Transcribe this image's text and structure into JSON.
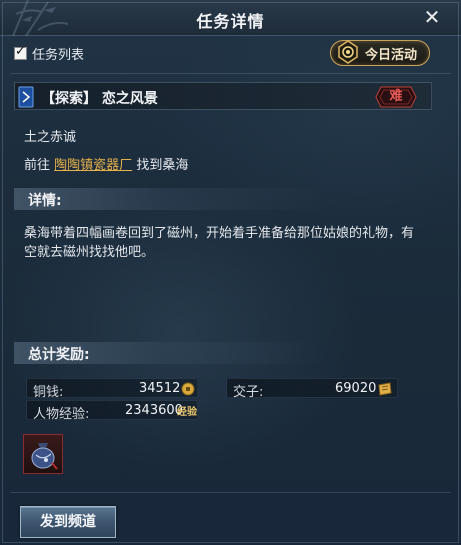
{
  "window": {
    "title": "任务详情"
  },
  "quest_list_toggle": {
    "label": "任务列表",
    "checked": true
  },
  "daily_button": {
    "label": "今日活动"
  },
  "quest": {
    "category": "【探索】",
    "name": "恋之风景",
    "difficulty": "难",
    "target_text": "土之赤诚",
    "goto_prefix": "前往",
    "goto_location": "陶陶镇瓷器厂",
    "goto_suffix": "找到桑海"
  },
  "details": {
    "header": "详情:",
    "text": "桑海带着四幅画卷回到了磁州，开始着手准备给那位姑娘的礼物，有空就去磁州找找他吧。"
  },
  "rewards": {
    "header": "总计奖励:",
    "copper_label": "铜钱:",
    "copper_value": "34512",
    "jiaozi_label": "交子:",
    "jiaozi_value": "69020",
    "exp_label": "人物经验:",
    "exp_value": "2343600",
    "exp_badge": "经验"
  },
  "send_button": {
    "label": "发到频道"
  },
  "colors": {
    "link": "#e5b04a",
    "difficulty": "#e85a56",
    "accent_gold": "#c9a35a"
  }
}
